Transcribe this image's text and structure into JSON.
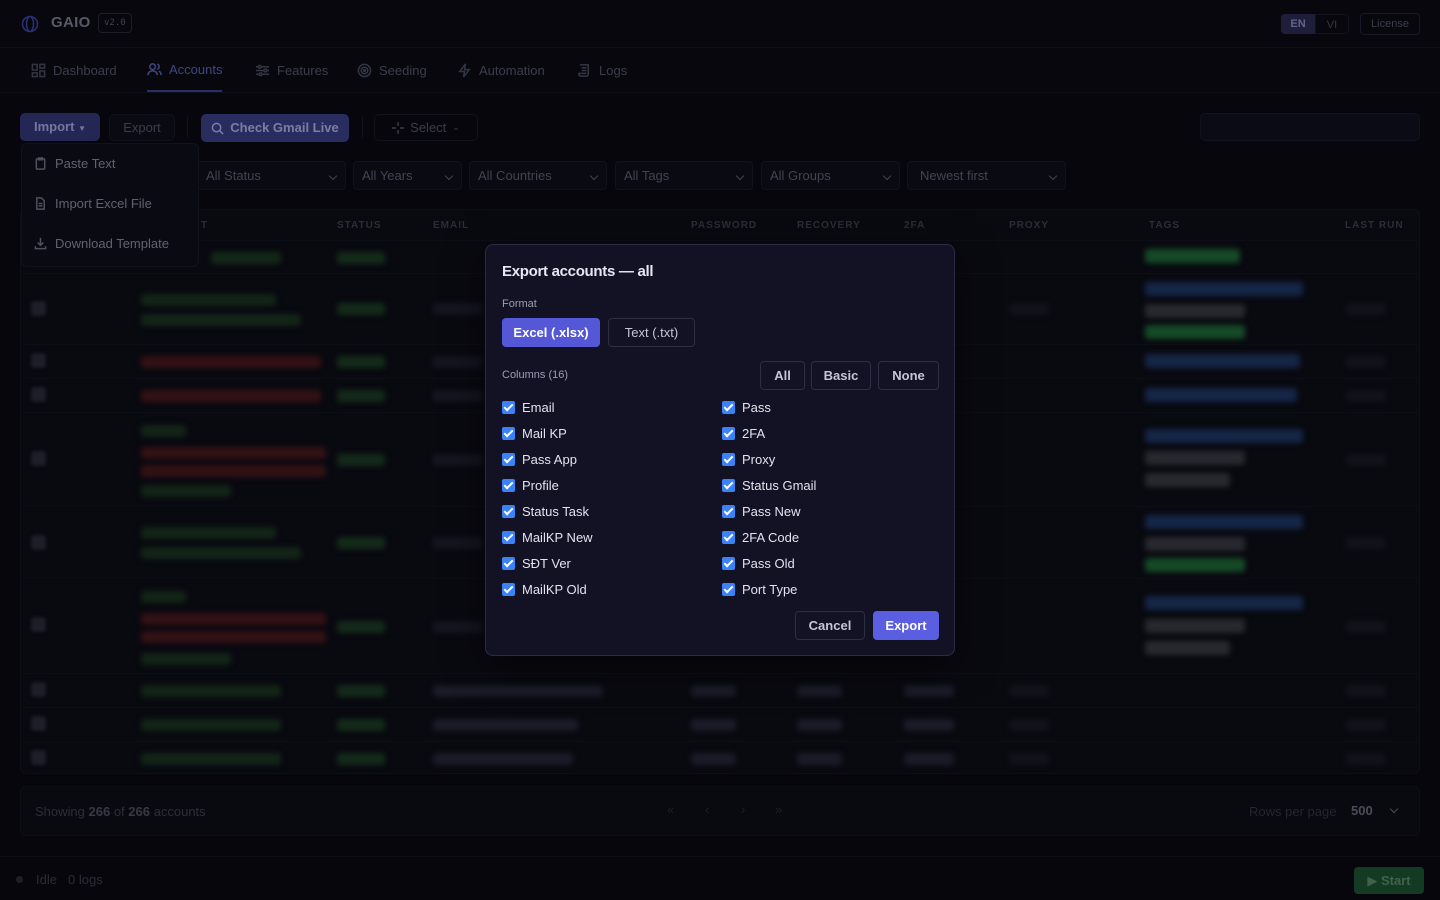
{
  "app": {
    "name": "GAIO",
    "version": "v2.0",
    "lang": [
      "EN",
      "VI"
    ],
    "license_label": "License"
  },
  "nav": {
    "tabs": [
      {
        "label": "Dashboard",
        "icon": "grid-icon"
      },
      {
        "label": "Accounts",
        "icon": "users-icon",
        "active": true
      },
      {
        "label": "Features",
        "icon": "sliders-icon"
      },
      {
        "label": "Seeding",
        "icon": "target-icon"
      },
      {
        "label": "Automation",
        "icon": "bolt-icon"
      },
      {
        "label": "Logs",
        "icon": "scroll-icon"
      }
    ]
  },
  "toolbar": {
    "import_label": "Import",
    "export_label": "Export",
    "check_label": "Check Gmail Live",
    "select_label": "Select"
  },
  "import_menu": {
    "items": [
      {
        "label": "Paste Text",
        "icon": "clipboard-icon"
      },
      {
        "label": "Import Excel File",
        "icon": "file-icon"
      },
      {
        "label": "Download Template",
        "icon": "download-icon"
      }
    ]
  },
  "filters": {
    "status": "All Status",
    "years": "All Years",
    "countries": "All Countries",
    "tags": "All Tags",
    "groups": "All Groups",
    "sort": "Newest first"
  },
  "table": {
    "headers": [
      "T",
      "STATUS",
      "EMAIL",
      "PASSWORD",
      "RECOVERY",
      "2FA",
      "PROXY",
      "TAGS",
      "LAST RUN"
    ]
  },
  "pager": {
    "showing_prefix": "Showing",
    "shown": "266",
    "of_label": "of",
    "total": "266",
    "suffix": "accounts",
    "first": "«",
    "prev": "‹",
    "next": "›",
    "last": "»",
    "rows_label": "Rows per page",
    "rows_value": "500"
  },
  "statusbar": {
    "state": "Idle",
    "logs": "0 logs",
    "start_label": "▶ Start"
  },
  "modal": {
    "title": "Export accounts — all",
    "format_label": "Format",
    "format_options": [
      "Excel (.xlsx)",
      "Text (.txt)"
    ],
    "selected_format": "Excel (.xlsx)",
    "columns_label": "Columns (16)",
    "preset_all": "All",
    "preset_basic": "Basic",
    "preset_none": "None",
    "columns_left": [
      "Email",
      "Mail KP",
      "Pass App",
      "Profile",
      "Status Task",
      "MailKP New",
      "SĐT Ver",
      "MailKP Old"
    ],
    "columns_right": [
      "Pass",
      "2FA",
      "Proxy",
      "Status Gmail",
      "Pass New",
      "2FA Code",
      "Pass Old",
      "Port Type"
    ],
    "cancel_label": "Cancel",
    "export_label": "Export"
  },
  "colors": {
    "accent": "#5558d6",
    "checkbox": "#3b82f6",
    "modal_bg": "#121224",
    "page_bg": "#0a0a12"
  }
}
